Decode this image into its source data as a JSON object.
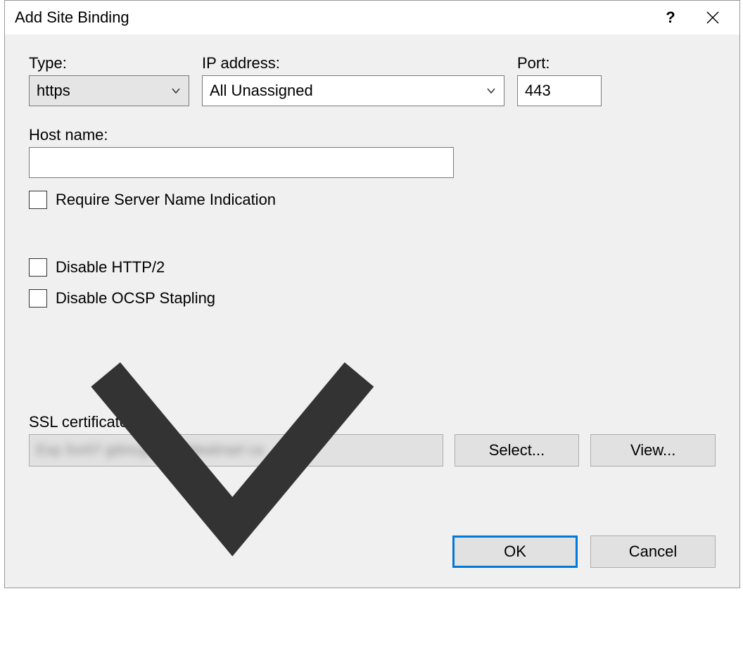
{
  "titlebar": {
    "title": "Add Site Binding",
    "help": "?"
  },
  "labels": {
    "type": "Type:",
    "ip": "IP address:",
    "port": "Port:",
    "hostname": "Host name:",
    "require_sni": "Require Server Name Indication",
    "disable_http2": "Disable HTTP/2",
    "disable_ocsp": "Disable OCSP Stapling",
    "ssl_cert": "SSL certificate:"
  },
  "values": {
    "type": "https",
    "ip": "All Unassigned",
    "port": "443",
    "hostname": "",
    "ssl_cert": "Exp Svr07 gdmcgv gooddealmart ca"
  },
  "buttons": {
    "select": "Select...",
    "view": "View...",
    "ok": "OK",
    "cancel": "Cancel"
  }
}
